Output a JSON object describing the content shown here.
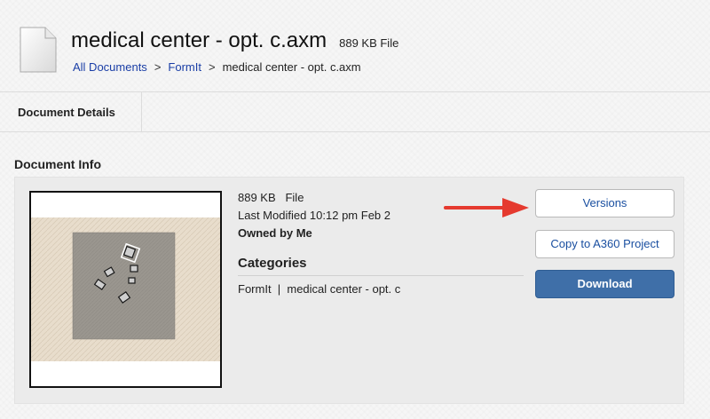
{
  "header": {
    "title": "medical center - opt. c.axm",
    "meta": "889 KB File",
    "icon": "document-file-icon"
  },
  "breadcrumb": {
    "items": [
      "All Documents",
      "FormIt"
    ],
    "separator": ">",
    "current": "medical center - opt. c.axm"
  },
  "tabs": {
    "details": "Document Details"
  },
  "document_info": {
    "section_title": "Document Info",
    "size_type": "889 KB   File",
    "last_modified": "Last Modified 10:12 pm Feb 2",
    "owner": "Owned by Me",
    "categories_title": "Categories",
    "categories": "FormIt  |  medical center - opt. c",
    "thumbnail_icon": "model-thumbnail"
  },
  "actions": {
    "versions": "Versions",
    "copy": "Copy to A360 Project",
    "download": "Download"
  },
  "colors": {
    "link": "#1a3ea6",
    "download_bg": "#3f6fa8",
    "annotation_arrow": "#e53a2f"
  }
}
